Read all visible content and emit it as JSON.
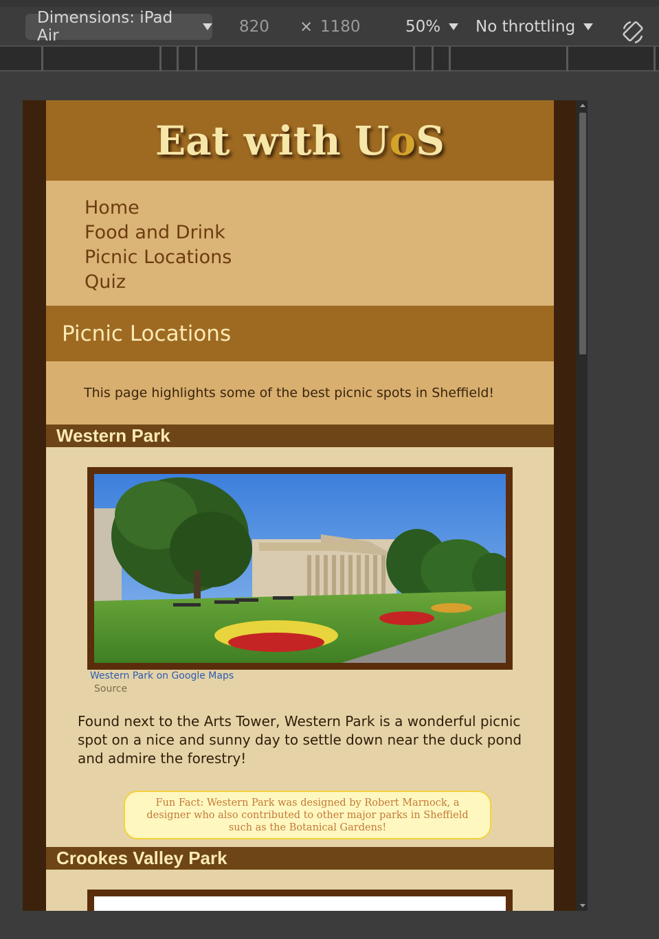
{
  "devtools": {
    "dimensions_label": "Dimensions: iPad Air",
    "width": "820",
    "times": "×",
    "height": "1180",
    "zoom": "50%",
    "throttling": "No throttling"
  },
  "site": {
    "title_pre": "Eat with U",
    "title_accent": "o",
    "title_post": "S"
  },
  "nav": {
    "items": [
      {
        "label": "Home"
      },
      {
        "label": "Food and Drink"
      },
      {
        "label": "Picnic Locations"
      },
      {
        "label": "Quiz"
      }
    ]
  },
  "page": {
    "heading": "Picnic Locations",
    "intro": "This page highlights some of the best picnic spots in Sheffield!"
  },
  "sections": [
    {
      "title": "Western Park",
      "caption_link": "Western Park on Google Maps",
      "caption_source": "Source",
      "description": "Found next to the Arts Tower, Western Park is a wonderful picnic spot on a nice and sunny day to settle down near the duck pond and admire the forestry!",
      "fun_fact": "Fun Fact: Western Park was designed by Robert Marnock, a designer who also contributed to other major parks in Sheffield such as the Botanical Gardens!"
    },
    {
      "title": "Crookes Valley Park"
    }
  ],
  "colors": {
    "header_bg": "#9e6a22",
    "nav_bg": "#dbb478",
    "section_head_bg": "#6e4516",
    "body_bg": "#e5d3a7",
    "fun_fact_bg": "#fff7c0"
  }
}
